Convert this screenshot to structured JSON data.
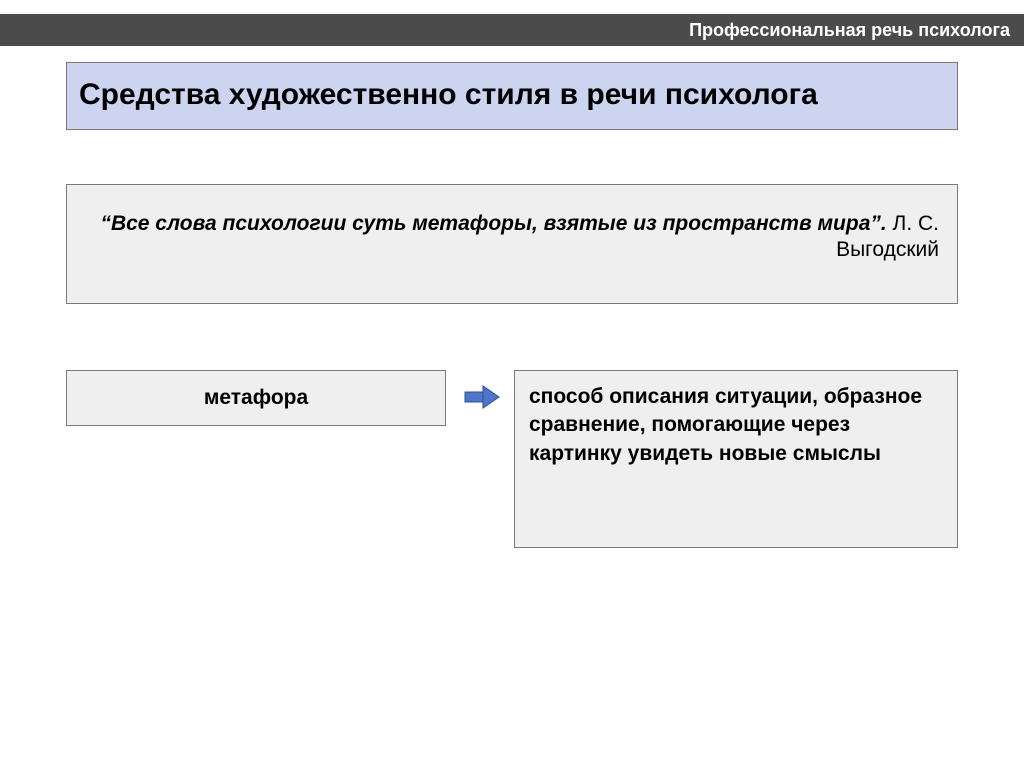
{
  "header": {
    "label": "Профессиональная речь психолога"
  },
  "title": "Средства художественно стиля в речи психолога",
  "quote": {
    "text": "“Все слова психологии суть метафоры, взятые из пространств мира”.",
    "author": "Л. С. Выгодский"
  },
  "term": "метафора",
  "definition": "способ описания ситуации, образное сравнение, помогающие через картинку увидеть новые смыслы",
  "arrow_name": "arrow-right"
}
